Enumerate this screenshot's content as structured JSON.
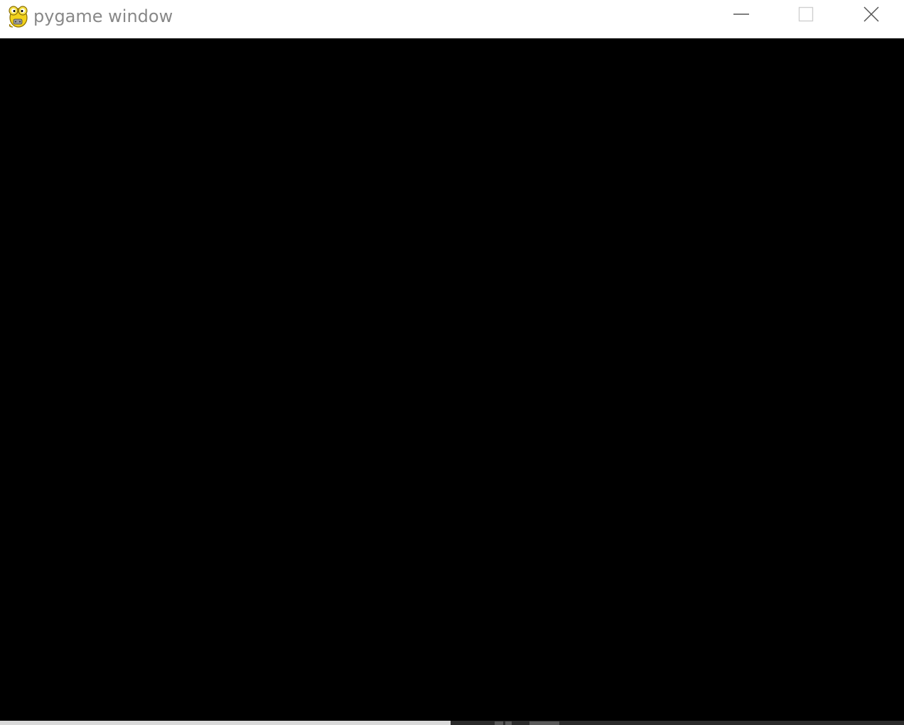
{
  "window": {
    "title": "pygame window",
    "app_icon": "pygame-snake-icon",
    "controls": {
      "minimize_icon": "minimize-icon",
      "maximize_icon": "maximize-icon",
      "close_icon": "close-icon"
    }
  },
  "canvas": {
    "background_color": "#000000"
  },
  "colors": {
    "titlebar_bg": "#ffffff",
    "title_text": "#888888",
    "control_glyph": "#555555"
  }
}
